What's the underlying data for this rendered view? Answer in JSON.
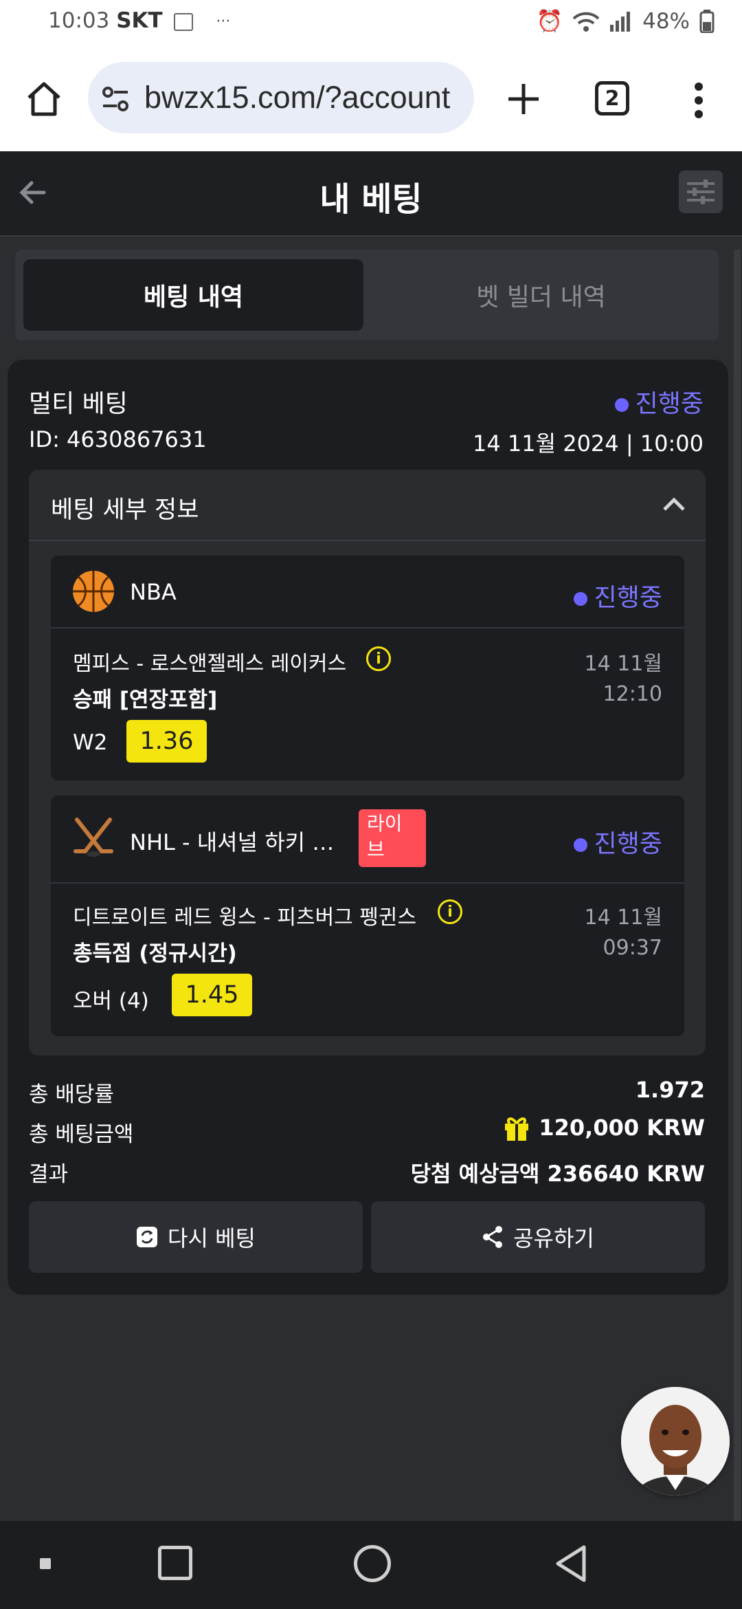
{
  "status_bar": {
    "time": "10:03",
    "carrier": "SKT",
    "more": "···",
    "battery": "48%"
  },
  "browser": {
    "url": "bwzx15.com/?account",
    "tab_count": "2"
  },
  "header": {
    "title": "내 베팅"
  },
  "tabs": [
    {
      "label": "베팅 내역"
    },
    {
      "label": "벳 빌더 내역"
    }
  ],
  "bet": {
    "type": "멀티 베팅",
    "status": "진행중",
    "id": "ID: 4630867631",
    "datetime": "14 11월 2024 | 10:00",
    "details_title": "베팅 세부 정보",
    "matches": [
      {
        "league": "NBA",
        "status": "진행중",
        "teams": "멤피스 - 로스앤젤레스 레이커스",
        "market": "승패 [연장포함]",
        "date": "14 11월",
        "time": "12:10",
        "selection": "W2",
        "odds": "1.36"
      },
      {
        "league": "NHL - 내셔널 하키 …",
        "live_badge": "라이브",
        "status": "진행중",
        "teams": "디트로이트 레드 윙스 - 피츠버그 펭귄스",
        "market": "총득점 (정규시간)",
        "date": "14 11월",
        "time": "09:37",
        "selection": "오버 (4)",
        "odds": "1.45"
      }
    ],
    "summary": {
      "total_odds_label": "총 배당률",
      "total_odds": "1.972",
      "total_stake_label": "총 베팅금액",
      "total_stake": "120,000 KRW",
      "result_label": "결과",
      "result": "당첨 예상금액 236640 KRW"
    },
    "buttons": {
      "rebet": "다시 베팅",
      "share": "공유하기"
    }
  },
  "colors": {
    "accent": "#7b75ff",
    "odds_bg": "#f5e50f",
    "live": "#ff4d57",
    "card": "#1c1d21"
  }
}
